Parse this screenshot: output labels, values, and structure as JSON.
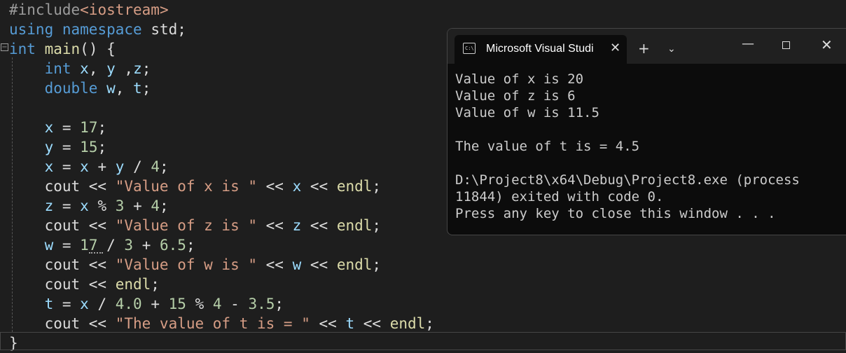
{
  "editor": {
    "lines": [
      [
        {
          "t": "#include",
          "c": "pp"
        },
        {
          "t": "<iostream>",
          "c": "inc"
        }
      ],
      [
        {
          "t": "using",
          "c": "kw"
        },
        {
          "t": " ",
          "c": "op"
        },
        {
          "t": "namespace",
          "c": "kw"
        },
        {
          "t": " std;",
          "c": "op"
        }
      ],
      [
        {
          "t": "int",
          "c": "kw"
        },
        {
          "t": " ",
          "c": "op"
        },
        {
          "t": "main",
          "c": "fn"
        },
        {
          "t": "() {",
          "c": "op"
        }
      ],
      [
        {
          "t": "    ",
          "c": "op"
        },
        {
          "t": "int",
          "c": "kw"
        },
        {
          "t": " ",
          "c": "op"
        },
        {
          "t": "x",
          "c": "var"
        },
        {
          "t": ", ",
          "c": "op"
        },
        {
          "t": "y",
          "c": "var"
        },
        {
          "t": " ,",
          "c": "op"
        },
        {
          "t": "z",
          "c": "var"
        },
        {
          "t": ";",
          "c": "op"
        }
      ],
      [
        {
          "t": "    ",
          "c": "op"
        },
        {
          "t": "double",
          "c": "kw"
        },
        {
          "t": " ",
          "c": "op"
        },
        {
          "t": "w",
          "c": "var"
        },
        {
          "t": ", ",
          "c": "op"
        },
        {
          "t": "t",
          "c": "var"
        },
        {
          "t": ";",
          "c": "op"
        }
      ],
      [],
      [
        {
          "t": "    ",
          "c": "op"
        },
        {
          "t": "x",
          "c": "var"
        },
        {
          "t": " = ",
          "c": "op"
        },
        {
          "t": "17",
          "c": "num"
        },
        {
          "t": ";",
          "c": "op"
        }
      ],
      [
        {
          "t": "    ",
          "c": "op"
        },
        {
          "t": "y",
          "c": "var"
        },
        {
          "t": " = ",
          "c": "op"
        },
        {
          "t": "15",
          "c": "num"
        },
        {
          "t": ";",
          "c": "op"
        }
      ],
      [
        {
          "t": "    ",
          "c": "op"
        },
        {
          "t": "x",
          "c": "var"
        },
        {
          "t": " = ",
          "c": "op"
        },
        {
          "t": "x",
          "c": "var"
        },
        {
          "t": " + ",
          "c": "op"
        },
        {
          "t": "y",
          "c": "var"
        },
        {
          "t": " / ",
          "c": "op"
        },
        {
          "t": "4",
          "c": "num"
        },
        {
          "t": ";",
          "c": "op"
        }
      ],
      [
        {
          "t": "    cout << ",
          "c": "op"
        },
        {
          "t": "\"Value of x is \"",
          "c": "str"
        },
        {
          "t": " << ",
          "c": "op"
        },
        {
          "t": "x",
          "c": "var"
        },
        {
          "t": " << ",
          "c": "op"
        },
        {
          "t": "endl",
          "c": "fn"
        },
        {
          "t": ";",
          "c": "op"
        }
      ],
      [
        {
          "t": "    ",
          "c": "op"
        },
        {
          "t": "z",
          "c": "var"
        },
        {
          "t": " = ",
          "c": "op"
        },
        {
          "t": "x",
          "c": "var"
        },
        {
          "t": " % ",
          "c": "op"
        },
        {
          "t": "3",
          "c": "num"
        },
        {
          "t": " + ",
          "c": "op"
        },
        {
          "t": "4",
          "c": "num"
        },
        {
          "t": ";",
          "c": "op"
        }
      ],
      [
        {
          "t": "    cout << ",
          "c": "op"
        },
        {
          "t": "\"Value of z is \"",
          "c": "str"
        },
        {
          "t": " << ",
          "c": "op"
        },
        {
          "t": "z",
          "c": "var"
        },
        {
          "t": " << ",
          "c": "op"
        },
        {
          "t": "endl",
          "c": "fn"
        },
        {
          "t": ";",
          "c": "op"
        }
      ],
      [
        {
          "t": "    ",
          "c": "op"
        },
        {
          "t": "w",
          "c": "var"
        },
        {
          "t": " = ",
          "c": "op"
        },
        {
          "t": "17",
          "c": "num"
        },
        {
          "t": " / ",
          "c": "op"
        },
        {
          "t": "3",
          "c": "num"
        },
        {
          "t": " + ",
          "c": "op"
        },
        {
          "t": "6.5",
          "c": "num"
        },
        {
          "t": ";",
          "c": "op"
        }
      ],
      [
        {
          "t": "    cout << ",
          "c": "op"
        },
        {
          "t": "\"Value of w is \"",
          "c": "str"
        },
        {
          "t": " << ",
          "c": "op"
        },
        {
          "t": "w",
          "c": "var"
        },
        {
          "t": " << ",
          "c": "op"
        },
        {
          "t": "endl",
          "c": "fn"
        },
        {
          "t": ";",
          "c": "op"
        }
      ],
      [
        {
          "t": "    cout << ",
          "c": "op"
        },
        {
          "t": "endl",
          "c": "fn"
        },
        {
          "t": ";",
          "c": "op"
        }
      ],
      [
        {
          "t": "    ",
          "c": "op"
        },
        {
          "t": "t",
          "c": "var"
        },
        {
          "t": " = ",
          "c": "op"
        },
        {
          "t": "x",
          "c": "var"
        },
        {
          "t": " / ",
          "c": "op"
        },
        {
          "t": "4.0",
          "c": "num"
        },
        {
          "t": " + ",
          "c": "op"
        },
        {
          "t": "15",
          "c": "num"
        },
        {
          "t": " % ",
          "c": "op"
        },
        {
          "t": "4",
          "c": "num"
        },
        {
          "t": " - ",
          "c": "op"
        },
        {
          "t": "3.5",
          "c": "num"
        },
        {
          "t": ";",
          "c": "op"
        }
      ],
      [
        {
          "t": "    cout << ",
          "c": "op"
        },
        {
          "t": "\"The value of t is = \"",
          "c": "str"
        },
        {
          "t": " << ",
          "c": "op"
        },
        {
          "t": "t",
          "c": "var"
        },
        {
          "t": " << ",
          "c": "op"
        },
        {
          "t": "endl",
          "c": "fn"
        },
        {
          "t": ";",
          "c": "op"
        }
      ],
      [
        {
          "t": "}",
          "c": "op"
        }
      ]
    ],
    "collapse_glyph": "−"
  },
  "console": {
    "tab_title": "Microsoft Visual Studi",
    "tab_icon_text": "C:\\",
    "tab_close_icon": "close-icon",
    "tab_close_glyph": "✕",
    "new_tab_glyph": "+",
    "dropdown_glyph": "⌄",
    "minimize_glyph": "—",
    "close_glyph": "✕",
    "output": [
      "Value of x is 20",
      "Value of z is 6",
      "Value of w is 11.5",
      "",
      "The value of t is = 4.5",
      "",
      "D:\\Project8\\x64\\Debug\\Project8.exe (process",
      "11844) exited with code 0.",
      "Press any key to close this window . . ."
    ]
  },
  "colors": {
    "editor_bg": "#1e1e1e",
    "keyword": "#569cd6",
    "string": "#d69d85",
    "number": "#b5cea8",
    "variable": "#9cdcfe",
    "function": "#dcdcaa",
    "console_bg": "#0c0c0c",
    "console_titlebar": "#202020"
  }
}
